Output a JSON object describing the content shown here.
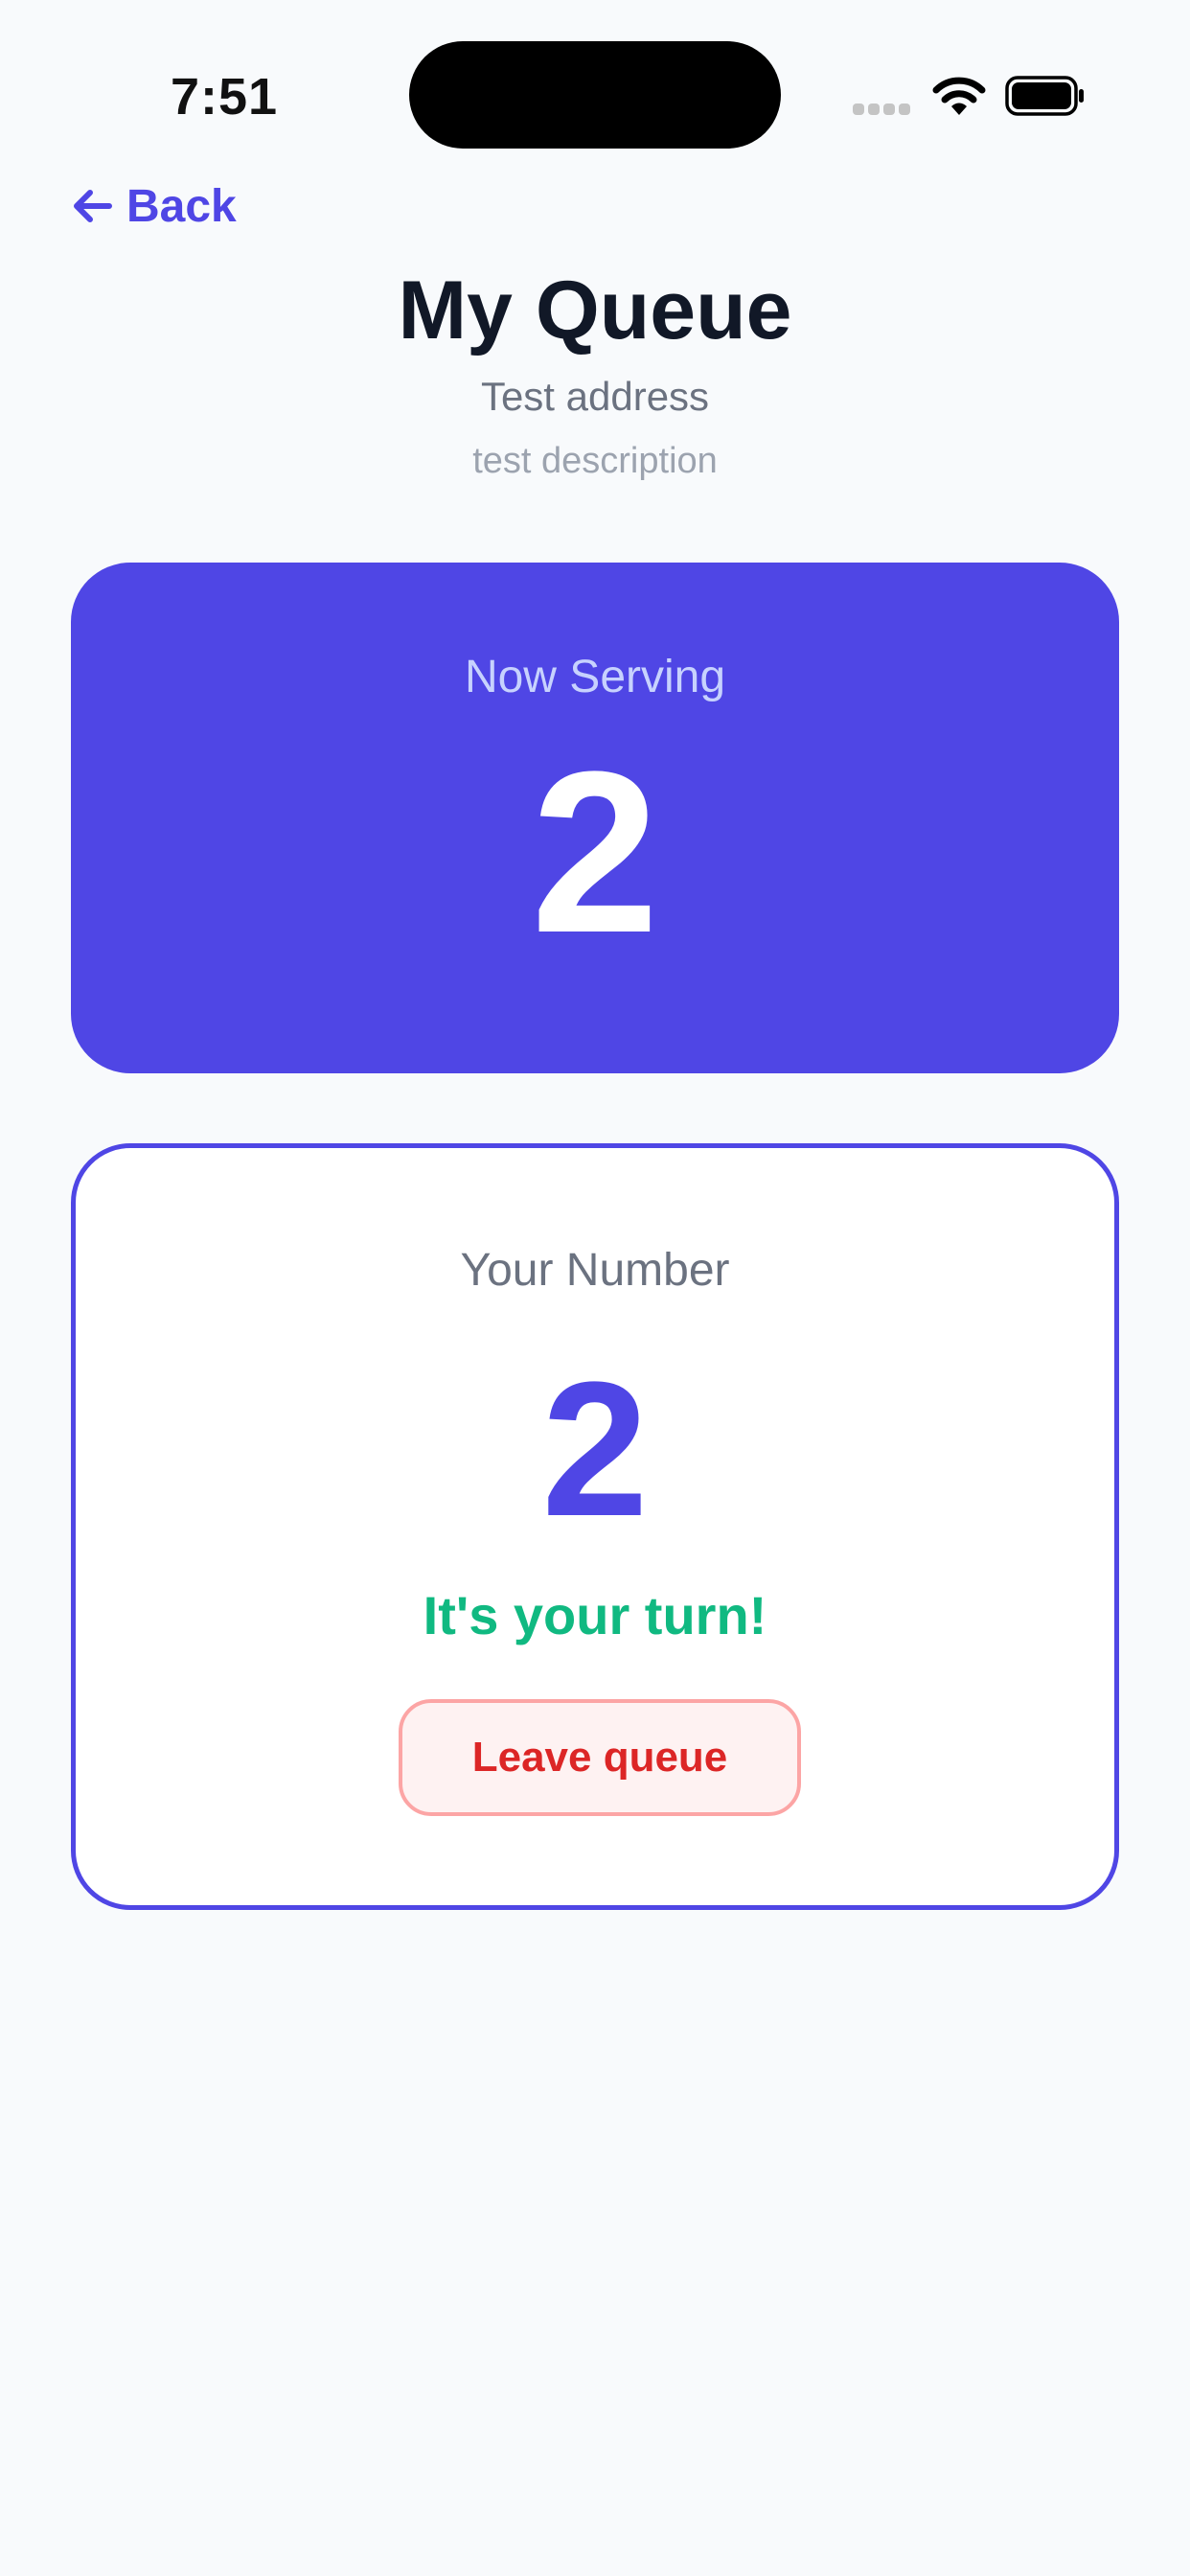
{
  "status_bar": {
    "time": "7:51"
  },
  "header": {
    "back_label": "Back",
    "title": "My Queue",
    "address": "Test address",
    "description": "test description"
  },
  "serving": {
    "label": "Now Serving",
    "number": "2"
  },
  "ticket": {
    "label": "Your Number",
    "number": "2",
    "message": "It's your turn!",
    "leave_label": "Leave queue"
  },
  "icons": {
    "back": "arrow-left-icon",
    "signal": "cellular-signal-icon",
    "wifi": "wifi-icon",
    "battery": "battery-icon"
  },
  "colors": {
    "accent": "#4f46e5",
    "success": "#10b981",
    "danger": "#dc2626",
    "danger_bg": "#fef2f2",
    "background": "#f8fafc"
  }
}
